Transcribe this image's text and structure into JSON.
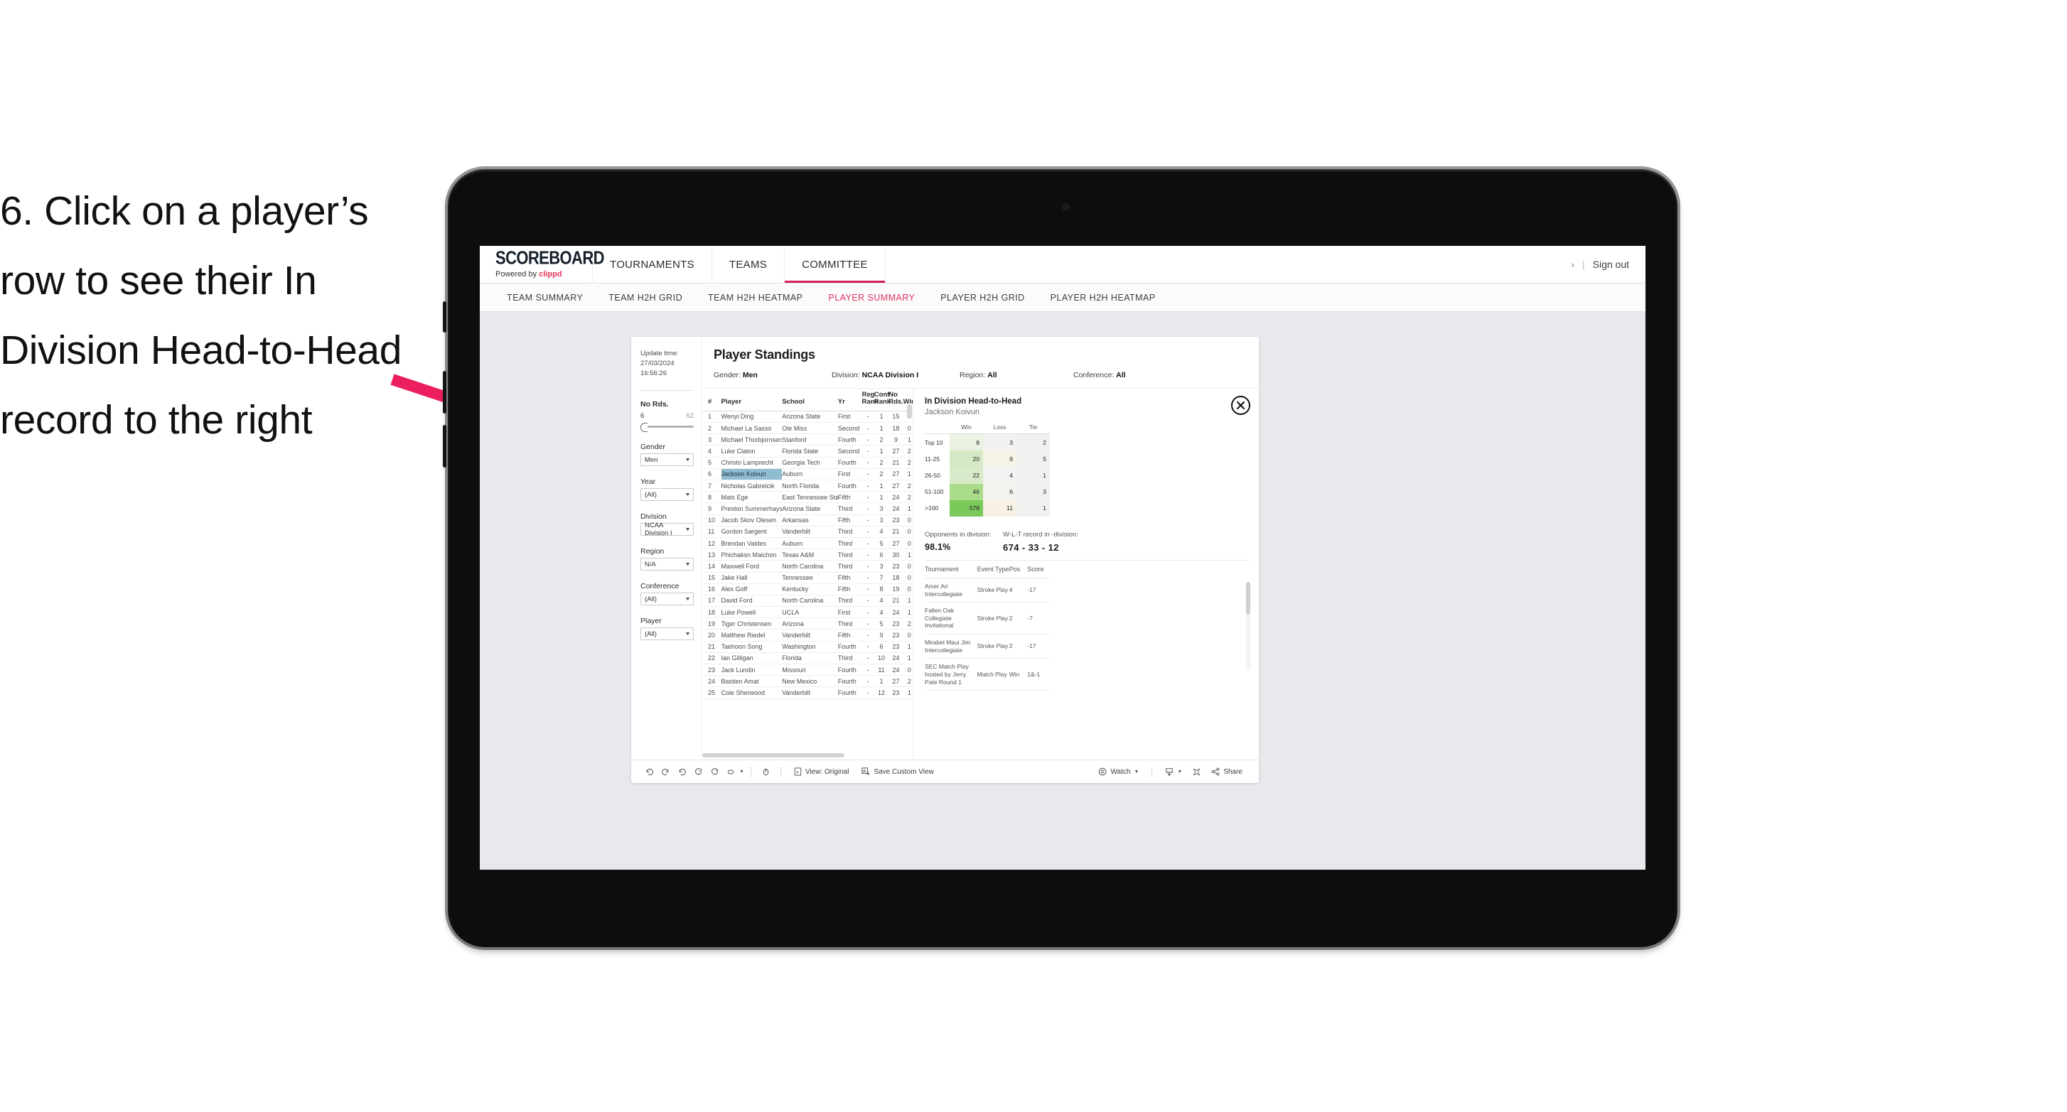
{
  "instruction": "6. Click on a player’s row to see their In Division Head-to-Head record to the right",
  "colors": {
    "accent_pink": "#d11f53",
    "arrow_pink": "#ec1f5e",
    "selection_blue": "#8fbcd0",
    "screen_bg": "#e8e9ec"
  },
  "topnav": {
    "brand_title": "SCOREBOARD",
    "brand_sub_prefix": "Powered by ",
    "brand_sub_brand": "clippd",
    "items": [
      {
        "label": "TOURNAMENTS",
        "active": false
      },
      {
        "label": "TEAMS",
        "active": false
      },
      {
        "label": "COMMITTEE",
        "active": true
      }
    ],
    "dots": "›",
    "separator": "|",
    "sign_out": "Sign out"
  },
  "subnav": {
    "items": [
      {
        "label": "TEAM SUMMARY",
        "active": false
      },
      {
        "label": "TEAM H2H GRID",
        "active": false
      },
      {
        "label": "TEAM H2H HEATMAP",
        "active": false
      },
      {
        "label": "PLAYER SUMMARY",
        "active": true
      },
      {
        "label": "PLAYER H2H GRID",
        "active": false
      },
      {
        "label": "PLAYER H2H HEATMAP",
        "active": false
      }
    ]
  },
  "filters": {
    "update_label": "Update time:",
    "update_value": "27/03/2024 16:56:26",
    "slider": {
      "title": "No Rds.",
      "min": "6",
      "max": "52"
    },
    "selects": [
      {
        "label": "Gender",
        "value": "Men"
      },
      {
        "label": "Year",
        "value": "(All)"
      },
      {
        "label": "Division",
        "value": "NCAA Division I"
      },
      {
        "label": "Region",
        "value": "N/A"
      },
      {
        "label": "Conference",
        "value": "(All)"
      },
      {
        "label": "Player",
        "value": "(All)"
      }
    ]
  },
  "main": {
    "title": "Player Standings",
    "meta": [
      {
        "label": "Gender: ",
        "value": "Men"
      },
      {
        "label": "Division: ",
        "value": "NCAA Division I"
      },
      {
        "label": "Region: ",
        "value": "All"
      },
      {
        "label": "Conference: ",
        "value": "All"
      }
    ]
  },
  "standings": {
    "columns": [
      "#",
      "Player",
      "School",
      "Yr",
      "Reg Rank",
      "Conf Rank",
      "No Rds.",
      "Wins"
    ],
    "columns_wrapped": [
      {
        "l1": "#",
        "l2": ""
      },
      {
        "l1": "",
        "l2": "Player"
      },
      {
        "l1": "",
        "l2": "School"
      },
      {
        "l1": "",
        "l2": "Yr"
      },
      {
        "l1": "Reg",
        "l2": "Rank"
      },
      {
        "l1": "Conf",
        "l2": "Rank"
      },
      {
        "l1": "No",
        "l2": "Rds."
      },
      {
        "l1": "",
        "l2": "Wins"
      }
    ],
    "rows": [
      {
        "num": "1",
        "player": "Wenyi Ding",
        "school": "Arizona State",
        "yr": "First",
        "reg": "-",
        "conf": "1",
        "rds": "15",
        "wins": "1",
        "selected": false
      },
      {
        "num": "2",
        "player": "Michael La Sasso",
        "school": "Ole Miss",
        "yr": "Second",
        "reg": "-",
        "conf": "1",
        "rds": "18",
        "wins": "0",
        "selected": false
      },
      {
        "num": "3",
        "player": "Michael Thorbjornsen",
        "school": "Stanford",
        "yr": "Fourth",
        "reg": "-",
        "conf": "2",
        "rds": "9",
        "wins": "1",
        "selected": false
      },
      {
        "num": "4",
        "player": "Luke Claton",
        "school": "Florida State",
        "yr": "Second",
        "reg": "-",
        "conf": "1",
        "rds": "27",
        "wins": "2",
        "selected": false
      },
      {
        "num": "5",
        "player": "Christo Lamprecht",
        "school": "Georgia Tech",
        "yr": "Fourth",
        "reg": "-",
        "conf": "2",
        "rds": "21",
        "wins": "2",
        "selected": false
      },
      {
        "num": "6",
        "player": "Jackson Koivun",
        "school": "Auburn",
        "yr": "First",
        "reg": "-",
        "conf": "2",
        "rds": "27",
        "wins": "1",
        "selected": true
      },
      {
        "num": "7",
        "player": "Nicholas Gabrelcik",
        "school": "North Florida",
        "yr": "Fourth",
        "reg": "-",
        "conf": "1",
        "rds": "27",
        "wins": "2",
        "selected": false
      },
      {
        "num": "8",
        "player": "Mats Ege",
        "school": "East Tennessee State",
        "yr": "Fifth",
        "reg": "-",
        "conf": "1",
        "rds": "24",
        "wins": "2",
        "selected": false
      },
      {
        "num": "9",
        "player": "Preston Summerhays",
        "school": "Arizona State",
        "yr": "Third",
        "reg": "-",
        "conf": "3",
        "rds": "24",
        "wins": "1",
        "selected": false
      },
      {
        "num": "10",
        "player": "Jacob Skov Olesen",
        "school": "Arkansas",
        "yr": "Fifth",
        "reg": "-",
        "conf": "3",
        "rds": "23",
        "wins": "0",
        "selected": false
      },
      {
        "num": "11",
        "player": "Gordon Sargent",
        "school": "Vanderbilt",
        "yr": "Third",
        "reg": "-",
        "conf": "4",
        "rds": "21",
        "wins": "0",
        "selected": false
      },
      {
        "num": "12",
        "player": "Brendan Valdes",
        "school": "Auburn",
        "yr": "Third",
        "reg": "-",
        "conf": "5",
        "rds": "27",
        "wins": "0",
        "selected": false
      },
      {
        "num": "13",
        "player": "Phichaksn Maichon",
        "school": "Texas A&M",
        "yr": "Third",
        "reg": "-",
        "conf": "6",
        "rds": "30",
        "wins": "1",
        "selected": false
      },
      {
        "num": "14",
        "player": "Maxwell Ford",
        "school": "North Carolina",
        "yr": "Third",
        "reg": "-",
        "conf": "3",
        "rds": "23",
        "wins": "0",
        "selected": false
      },
      {
        "num": "15",
        "player": "Jake Hall",
        "school": "Tennessee",
        "yr": "Fifth",
        "reg": "-",
        "conf": "7",
        "rds": "18",
        "wins": "0",
        "selected": false
      },
      {
        "num": "16",
        "player": "Alex Goff",
        "school": "Kentucky",
        "yr": "Fifth",
        "reg": "-",
        "conf": "8",
        "rds": "19",
        "wins": "0",
        "selected": false
      },
      {
        "num": "17",
        "player": "David Ford",
        "school": "North Carolina",
        "yr": "Third",
        "reg": "-",
        "conf": "4",
        "rds": "21",
        "wins": "1",
        "selected": false
      },
      {
        "num": "18",
        "player": "Luke Powell",
        "school": "UCLA",
        "yr": "First",
        "reg": "-",
        "conf": "4",
        "rds": "24",
        "wins": "1",
        "selected": false
      },
      {
        "num": "19",
        "player": "Tiger Christensen",
        "school": "Arizona",
        "yr": "Third",
        "reg": "-",
        "conf": "5",
        "rds": "23",
        "wins": "2",
        "selected": false
      },
      {
        "num": "20",
        "player": "Matthew Riedel",
        "school": "Vanderbilt",
        "yr": "Fifth",
        "reg": "-",
        "conf": "9",
        "rds": "23",
        "wins": "0",
        "selected": false
      },
      {
        "num": "21",
        "player": "Taehoon Song",
        "school": "Washington",
        "yr": "Fourth",
        "reg": "-",
        "conf": "6",
        "rds": "23",
        "wins": "1",
        "selected": false
      },
      {
        "num": "22",
        "player": "Ian Gilligan",
        "school": "Florida",
        "yr": "Third",
        "reg": "-",
        "conf": "10",
        "rds": "24",
        "wins": "1",
        "selected": false
      },
      {
        "num": "23",
        "player": "Jack Lundin",
        "school": "Missouri",
        "yr": "Fourth",
        "reg": "-",
        "conf": "11",
        "rds": "24",
        "wins": "0",
        "selected": false
      },
      {
        "num": "24",
        "player": "Bastien Amat",
        "school": "New Mexico",
        "yr": "Fourth",
        "reg": "-",
        "conf": "1",
        "rds": "27",
        "wins": "2",
        "selected": false
      },
      {
        "num": "25",
        "player": "Cole Sherwood",
        "school": "Vanderbilt",
        "yr": "Fourth",
        "reg": "-",
        "conf": "12",
        "rds": "23",
        "wins": "1",
        "selected": false
      }
    ]
  },
  "h2h": {
    "title": "In Division Head-to-Head",
    "player": "Jackson Koivun",
    "close_icon": "close-circle-icon",
    "chart_data": {
      "type": "heatmap",
      "title": "In Division Head-to-Head",
      "subtitle": "Jackson Koivun",
      "columns": [
        "Win",
        "Loss",
        "Tie"
      ],
      "rows": [
        "Top 10",
        "11-25",
        "26-50",
        "51-100",
        ">100"
      ],
      "values": [
        [
          8,
          3,
          2
        ],
        [
          20,
          9,
          5
        ],
        [
          22,
          4,
          1
        ],
        [
          46,
          6,
          3
        ],
        [
          578,
          11,
          1
        ]
      ],
      "cell_colors": [
        [
          "#e9f2e3",
          "#f1f1f0",
          "#f0f0ef"
        ],
        [
          "#d5e9c4",
          "#f6f2e6",
          "#f0f0ef"
        ],
        [
          "#d8eac9",
          "#f2f2f0",
          "#f0f0ef"
        ],
        [
          "#a9dc8b",
          "#f3f2ee",
          "#f0f0ef"
        ],
        [
          "#7ac95a",
          "#f6f1e3",
          "#f0f0ef"
        ]
      ]
    },
    "stats": [
      {
        "label": "Opponents in division:",
        "value": "98.1%"
      },
      {
        "label": "W-L-T record in -division:",
        "value": "674 - 33 - 12"
      }
    ],
    "tournaments": {
      "columns": [
        "Tournament",
        "Event Type",
        "Pos",
        "Score"
      ],
      "rows": [
        {
          "name": "Amer Ari Intercollegiate",
          "type": "Stroke Play",
          "pos": "4",
          "score": "-17"
        },
        {
          "name": "Fallen Oak Collegiate Invitational",
          "type": "Stroke Play",
          "pos": "2",
          "score": "-7"
        },
        {
          "name": "Mirabel Maui Jim Intercollegiate",
          "type": "Stroke Play",
          "pos": "2",
          "score": "-17"
        },
        {
          "name": "SEC Match Play hosted by Jerry Pate Round 1",
          "type": "Match Play",
          "pos": "Win",
          "score": "1&-1"
        }
      ]
    }
  },
  "toolbar": {
    "icons": [
      "undo-icon",
      "redo-icon",
      "revert-icon",
      "refresh-icon",
      "pause-icon",
      "shape-icon"
    ],
    "view_label": "View: Original",
    "save_label": "Save Custom View",
    "watch_label": "Watch",
    "share_label": "Share",
    "download_icon": "download-icon",
    "fullscreen_icon": "fullscreen-icon",
    "share_icon": "share-icon",
    "view_icon": "view-original-icon",
    "save_icon": "save-view-icon",
    "watch_icon": "watch-icon"
  }
}
